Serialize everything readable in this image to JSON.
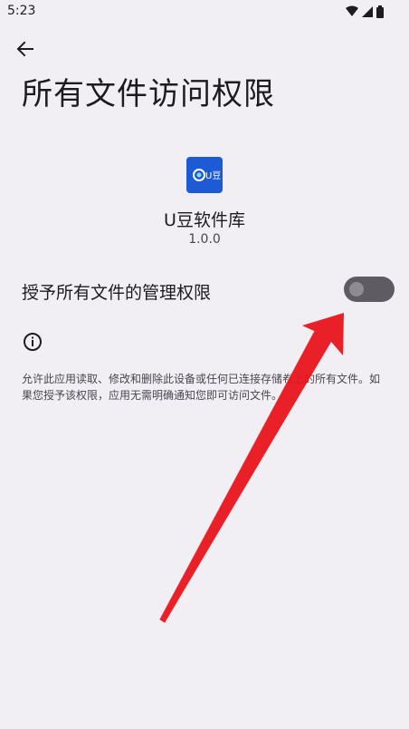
{
  "status_bar": {
    "time": "5:23",
    "icons": [
      "wifi-icon",
      "cell-signal-icon",
      "battery-icon"
    ]
  },
  "header": {
    "back_icon": "arrow-left-icon",
    "title": "所有文件访问权限"
  },
  "app": {
    "icon_color": "#1d5bd6",
    "logo_text": "U豆",
    "name": "U豆软件库",
    "version": "1.0.0"
  },
  "setting": {
    "label": "授予所有文件的管理权限",
    "enabled": false
  },
  "info": {
    "icon": "info-icon",
    "description": "允许此应用读取、修改和删除此设备或任何已连接存储卷上的所有文件。如果您授予该权限，应用无需明确通知您即可访问文件。"
  },
  "annotation": {
    "arrow_color": "#e8141b"
  }
}
